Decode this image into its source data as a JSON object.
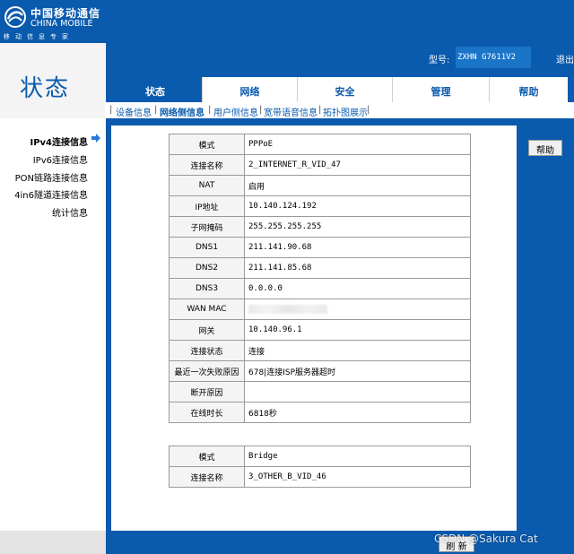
{
  "logo": {
    "cn": "中国移动通信",
    "en": "CHINA MOBILE",
    "tagline": "移动信息专家",
    "icon": "china-mobile-logo-icon"
  },
  "header": {
    "page_title": "状态",
    "model_label": "型号:",
    "model_value": "ZXHN G7611V2",
    "logout": "退出"
  },
  "tabs": [
    {
      "label": "状态",
      "active": true
    },
    {
      "label": "网络",
      "active": false
    },
    {
      "label": "安全",
      "active": false
    },
    {
      "label": "管理",
      "active": false
    },
    {
      "label": "帮助",
      "active": false
    }
  ],
  "subnav": [
    {
      "label": "设备信息",
      "active": false
    },
    {
      "label": "网络侧信息",
      "active": true
    },
    {
      "label": "用户侧信息",
      "active": false
    },
    {
      "label": "宽带语音信息",
      "active": false
    },
    {
      "label": "拓扑图展示",
      "active": false
    }
  ],
  "sidenav": [
    {
      "label": "IPv4连接信息",
      "active": true
    },
    {
      "label": "IPv6连接信息",
      "active": false
    },
    {
      "label": "PON链路连接信息",
      "active": false
    },
    {
      "label": "4in6隧道连接信息",
      "active": false
    },
    {
      "label": "统计信息",
      "active": false
    }
  ],
  "connection1": [
    {
      "key": "模式",
      "value": "PPPoE"
    },
    {
      "key": "连接名称",
      "value": "2_INTERNET_R_VID_47"
    },
    {
      "key": "NAT",
      "value": "启用"
    },
    {
      "key": "IP地址",
      "value": "10.140.124.192"
    },
    {
      "key": "子网掩码",
      "value": "255.255.255.255"
    },
    {
      "key": "DNS1",
      "value": "211.141.90.68"
    },
    {
      "key": "DNS2",
      "value": "211.141.85.68"
    },
    {
      "key": "DNS3",
      "value": "0.0.0.0"
    },
    {
      "key": "WAN MAC",
      "value": ""
    },
    {
      "key": "网关",
      "value": "10.140.96.1"
    },
    {
      "key": "连接状态",
      "value": "连接"
    },
    {
      "key": "最近一次失败原因",
      "value": "678|连接ISP服务器超时"
    },
    {
      "key": "断开原因",
      "value": ""
    },
    {
      "key": "在线时长",
      "value": "6818秒"
    }
  ],
  "connection2": [
    {
      "key": "模式",
      "value": "Bridge"
    },
    {
      "key": "连接名称",
      "value": "3_OTHER_B_VID_46"
    }
  ],
  "buttons": {
    "help": "帮助",
    "refresh": "刷 新"
  },
  "watermark": "CSDN @Sakura Cat",
  "colors": {
    "primary_blue": "#0a5aad",
    "panel_gray": "#f4f4f4"
  }
}
